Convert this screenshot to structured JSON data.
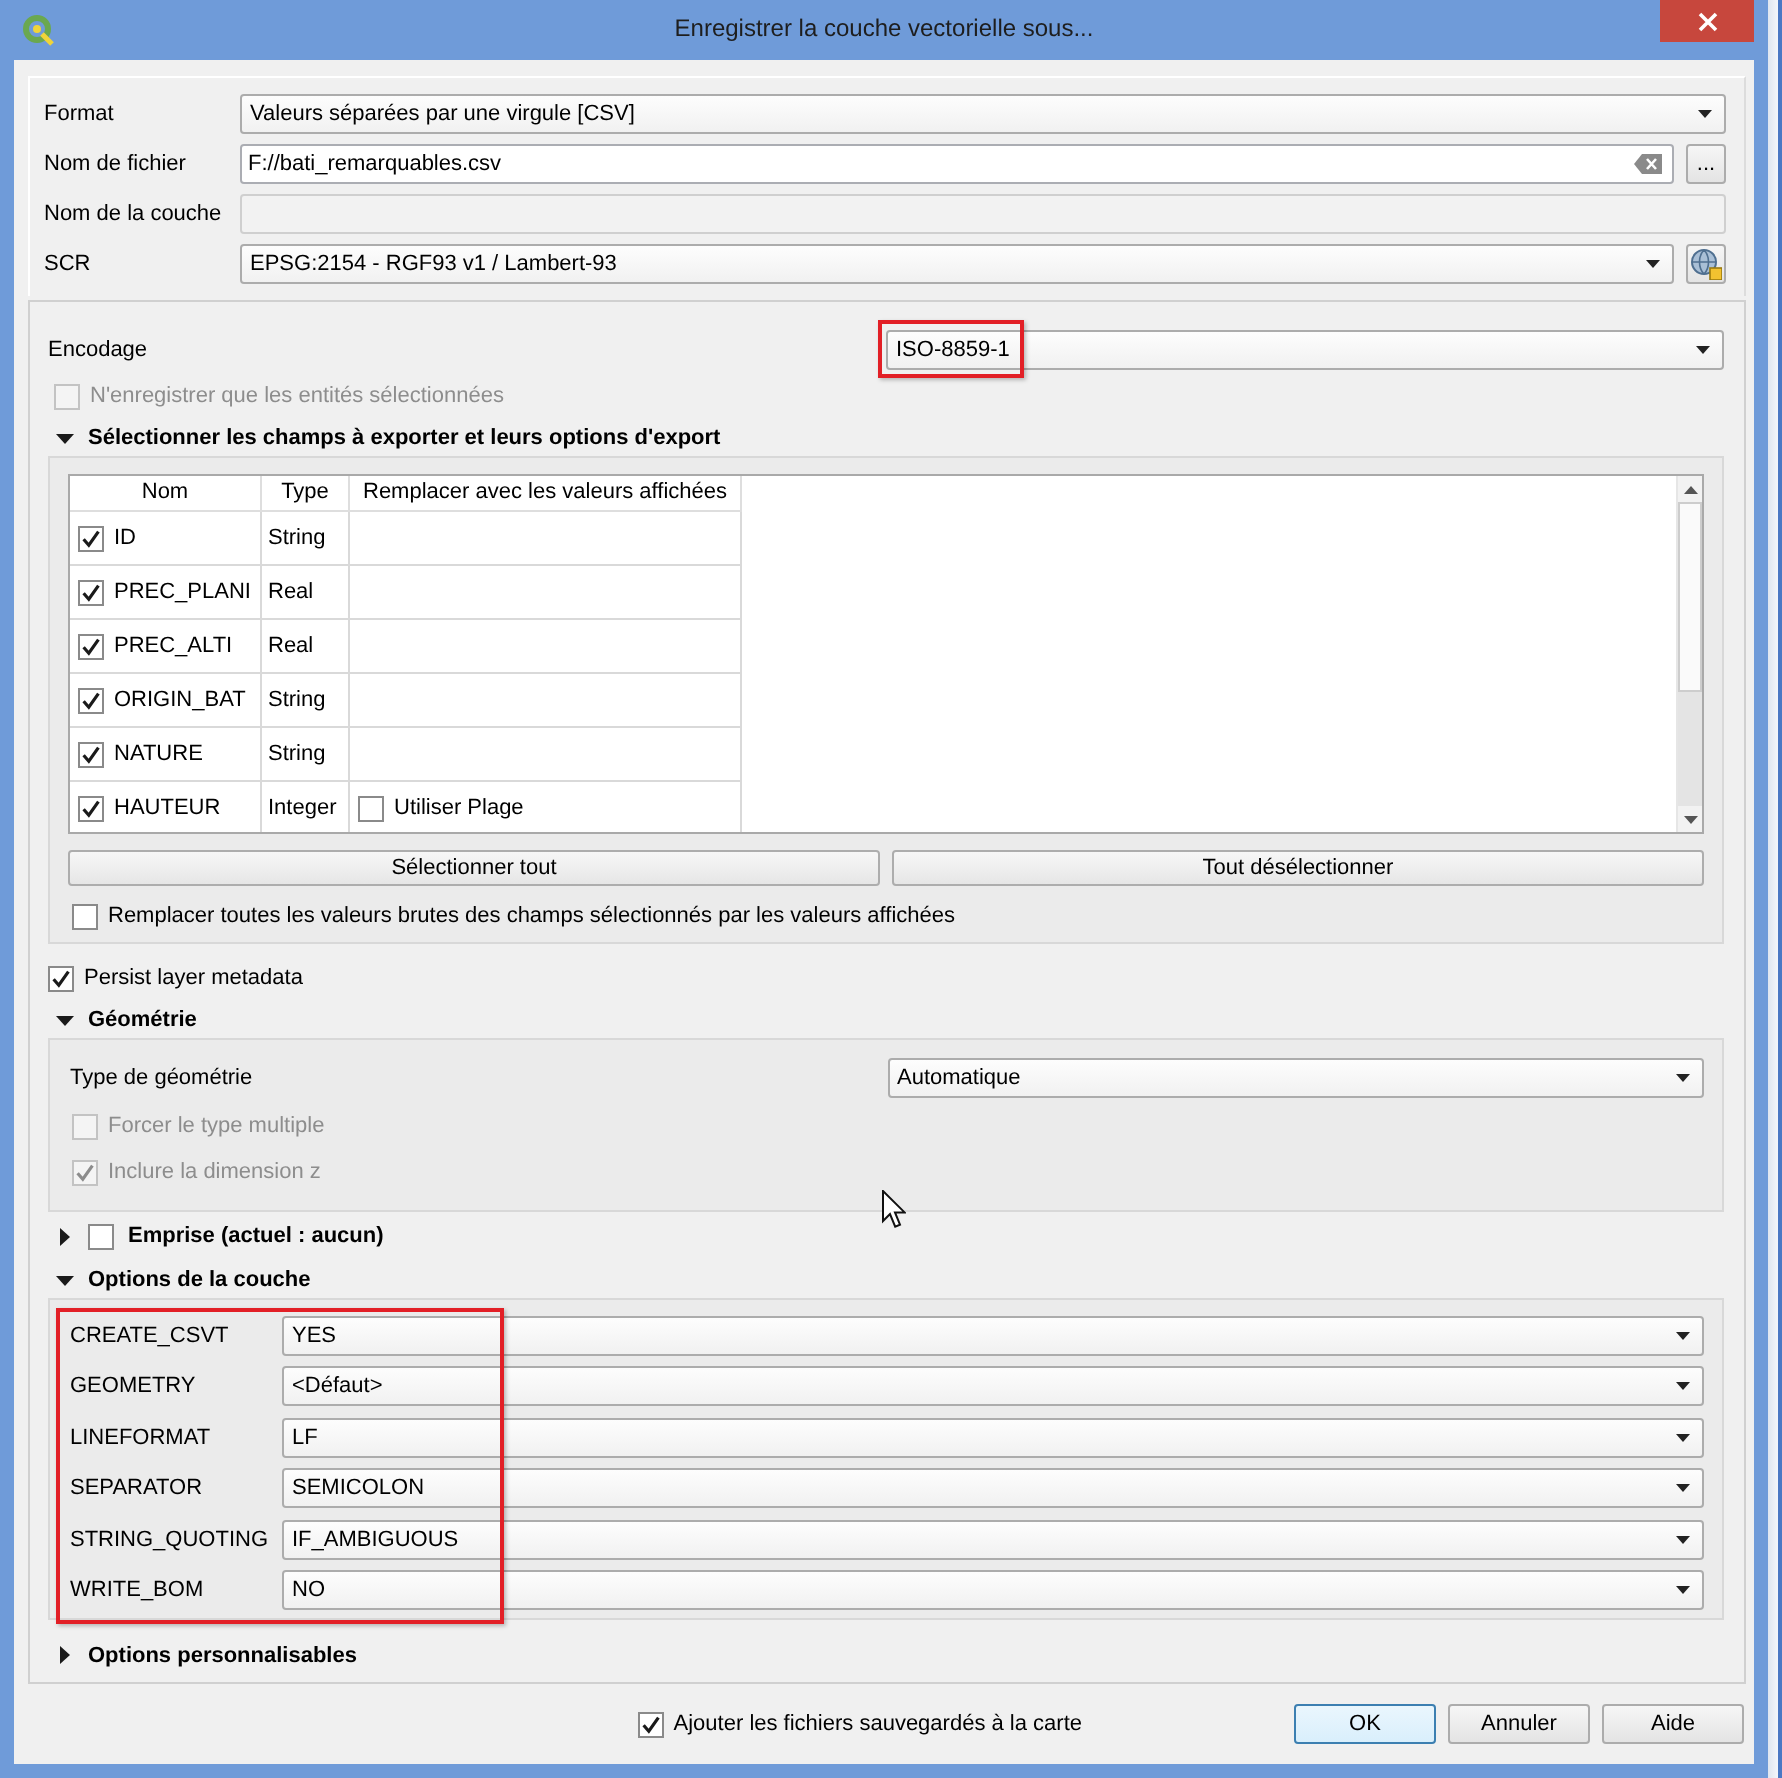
{
  "window": {
    "title": "Enregistrer la couche vectorielle sous..."
  },
  "general": {
    "format": {
      "label": "Format",
      "value": "Valeurs séparées par une virgule [CSV]"
    },
    "file_name": {
      "label": "Nom de fichier",
      "value": "F://bati_remarquables.csv",
      "browse_button": "..."
    },
    "layer_name": {
      "label": "Nom de la couche",
      "disabled": true
    },
    "crs": {
      "label": "SCR",
      "value": "EPSG:2154 - RGF93 v1 / Lambert-93"
    }
  },
  "encoding": {
    "label": "Encodage",
    "value": "ISO-8859-1",
    "highlighted": true
  },
  "selected_only": {
    "label": "N'enregistrer que les entités sélectionnées",
    "checked": false,
    "disabled": true
  },
  "fields_section": {
    "title": "Sélectionner les champs à exporter et leurs options d'export",
    "expanded": true,
    "table": {
      "columns": [
        "Nom",
        "Type",
        "Remplacer avec les valeurs affichées"
      ],
      "rows": [
        {
          "name": "ID",
          "checked": true,
          "type": "String"
        },
        {
          "name": "PREC_PLANI",
          "checked": true,
          "type": "Real"
        },
        {
          "name": "PREC_ALTI",
          "checked": true,
          "type": "Real"
        },
        {
          "name": "ORIGIN_BAT",
          "checked": true,
          "type": "String"
        },
        {
          "name": "NATURE",
          "checked": true,
          "type": "String"
        },
        {
          "name": "HAUTEUR",
          "checked": true,
          "type": "Integer",
          "replace": {
            "label": "Utiliser Plage",
            "checked": false
          }
        }
      ]
    },
    "buttons": [
      "Sélectionner tout",
      "Tout désélectionner"
    ],
    "replace_all": {
      "label": "Remplacer toutes les valeurs brutes des champs sélectionnés par les valeurs affichées",
      "checked": false
    }
  },
  "persist_metadata": {
    "label": "Persist layer metadata",
    "checked": true
  },
  "geometry_section": {
    "title": "Géométrie",
    "expanded": true,
    "geometry_type": {
      "label": "Type de géométrie",
      "value": "Automatique"
    },
    "options": [
      {
        "label": "Forcer le type multiple",
        "checked": false,
        "disabled": true
      },
      {
        "label": "Inclure la dimension z",
        "checked": true,
        "disabled": true
      }
    ]
  },
  "extent_section": {
    "title": "Emprise (actuel : aucun)",
    "expanded": false,
    "checked": false
  },
  "layer_options_section": {
    "title": "Options de la couche",
    "expanded": true,
    "highlighted": true,
    "options": [
      {
        "label": "CREATE_CSVT",
        "value": "YES"
      },
      {
        "label": "GEOMETRY",
        "value": "<Défaut>"
      },
      {
        "label": "LINEFORMAT",
        "value": "LF"
      },
      {
        "label": "SEPARATOR",
        "value": "SEMICOLON"
      },
      {
        "label": "STRING_QUOTING",
        "value": "IF_AMBIGUOUS"
      },
      {
        "label": "WRITE_BOM",
        "value": "NO"
      }
    ]
  },
  "custom_options_section": {
    "title": "Options personnalisables",
    "expanded": false
  },
  "add_to_map": {
    "label": "Ajouter les fichiers sauvegardés à la carte",
    "checked": true
  },
  "buttons": [
    {
      "label": "OK",
      "default": true
    },
    {
      "label": "Annuler",
      "default": false
    },
    {
      "label": "Aide",
      "default": false
    }
  ]
}
